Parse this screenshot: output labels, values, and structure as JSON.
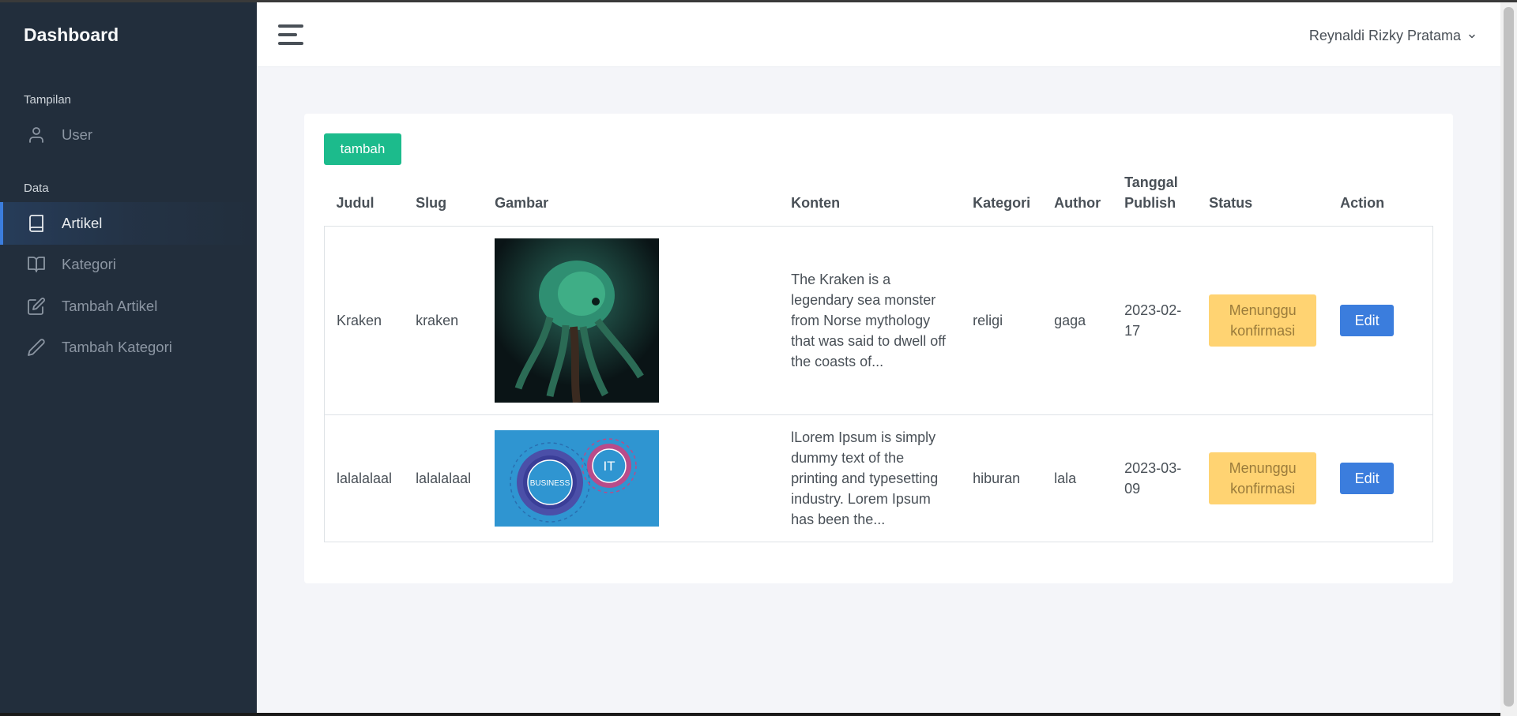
{
  "sidebar": {
    "brand": "Dashboard",
    "sections": [
      {
        "title": "Tampilan",
        "items": [
          {
            "label": "User",
            "icon": "user-icon",
            "active": false
          }
        ]
      },
      {
        "title": "Data",
        "items": [
          {
            "label": "Artikel",
            "icon": "book-icon",
            "active": true
          },
          {
            "label": "Kategori",
            "icon": "book-open-icon",
            "active": false
          },
          {
            "label": "Tambah Artikel",
            "icon": "edit-icon",
            "active": false
          },
          {
            "label": "Tambah Kategori",
            "icon": "pencil-icon",
            "active": false
          }
        ]
      }
    ]
  },
  "topbar": {
    "menu_icon": "hamburger-icon",
    "user_name": "Reynaldi Rizky Pratama",
    "user_chevron": "chevron-down-icon"
  },
  "main": {
    "add_button": "tambah",
    "table": {
      "headers": {
        "judul": "Judul",
        "slug": "Slug",
        "gambar": "Gambar",
        "konten": "Konten",
        "kategori": "Kategori",
        "author": "Author",
        "tanggal_line1": "Tanggal",
        "tanggal_line2": "Publish",
        "status": "Status",
        "action": "Action"
      },
      "rows": [
        {
          "judul": "Kraken",
          "slug": "kraken",
          "image": "kraken-artwork",
          "konten": "The Kraken is a legendary sea monster from Norse mythology that was said to dwell off the coasts of...",
          "kategori": "religi",
          "author": "gaga",
          "tanggal": "2023-02-17",
          "status": "Menunggu konfirmasi",
          "action": "Edit"
        },
        {
          "judul": "lalalalaal",
          "slug": "lalalalaal",
          "image": "business-it-gears",
          "image_text_business": "BUSINESS",
          "image_text_it": "IT",
          "konten": "lLorem Ipsum is simply dummy text of the printing and typesetting industry. Lorem Ipsum has been the...",
          "kategori": "hiburan",
          "author": "lala",
          "tanggal": "2023-03-09",
          "status": "Menunggu konfirmasi",
          "action": "Edit"
        }
      ]
    }
  },
  "colors": {
    "sidebar_bg": "#222e3c",
    "primary": "#3b7ddd",
    "success": "#1cbb8c",
    "warning": "#ffd372",
    "page_bg": "#f4f5f9"
  }
}
